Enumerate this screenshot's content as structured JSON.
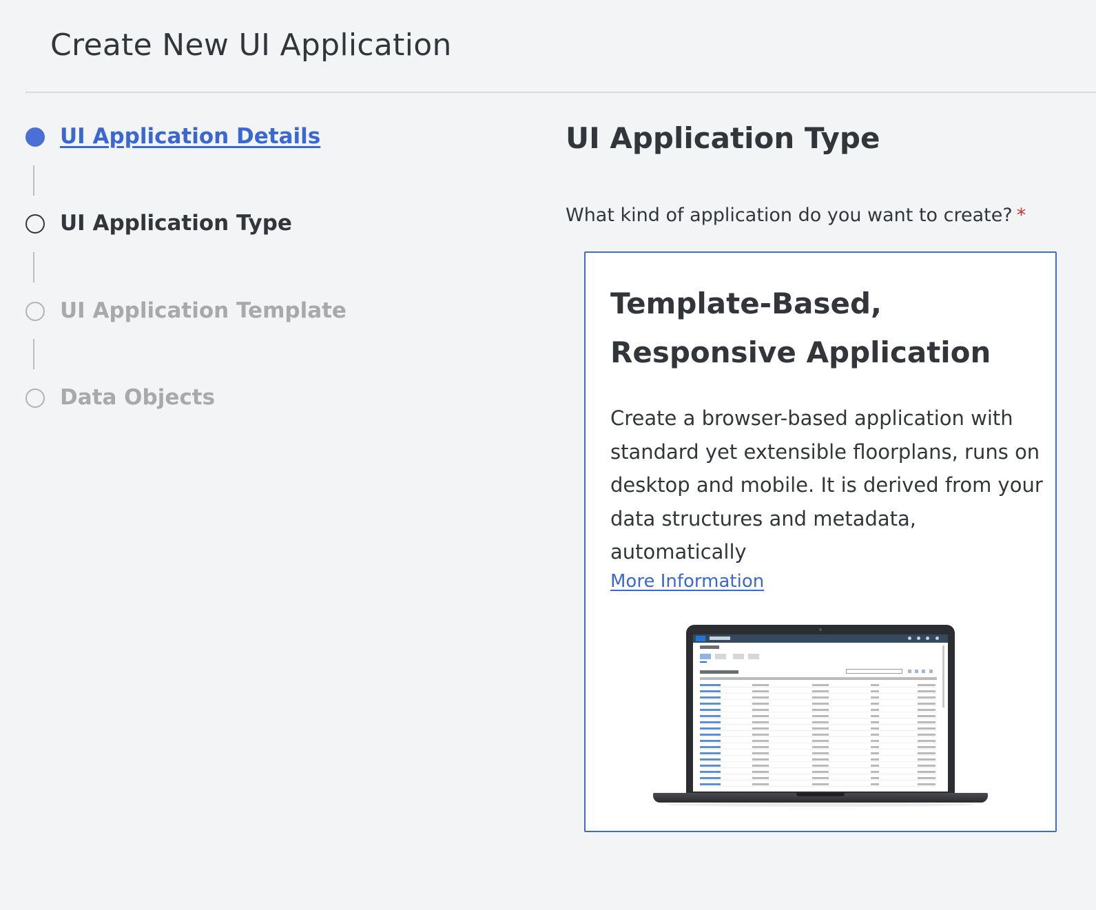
{
  "header": {
    "title": "Create New UI Application"
  },
  "wizard": {
    "steps": [
      {
        "label": "UI Application Details",
        "state": "active"
      },
      {
        "label": "UI Application Type",
        "state": "current"
      },
      {
        "label": "UI Application Template",
        "state": "disabled"
      },
      {
        "label": "Data Objects",
        "state": "disabled"
      }
    ]
  },
  "main": {
    "section_title": "UI Application Type",
    "question": "What kind of application do you want to create?",
    "required_marker": "*",
    "card": {
      "title": "Template-Based, Responsive Application",
      "description": "Create a browser-based application with standard yet extensible floorplans, runs on desktop and mobile. It is derived from your data structures and metadata, automatically",
      "link_label": "More Information",
      "image": "laptop-list-report-preview"
    }
  },
  "colors": {
    "accent": "#3b67d0",
    "active_step": "#4a6fd5",
    "card_border": "#3d6cc9",
    "required": "#d0312d",
    "background": "#f3f4f5"
  }
}
